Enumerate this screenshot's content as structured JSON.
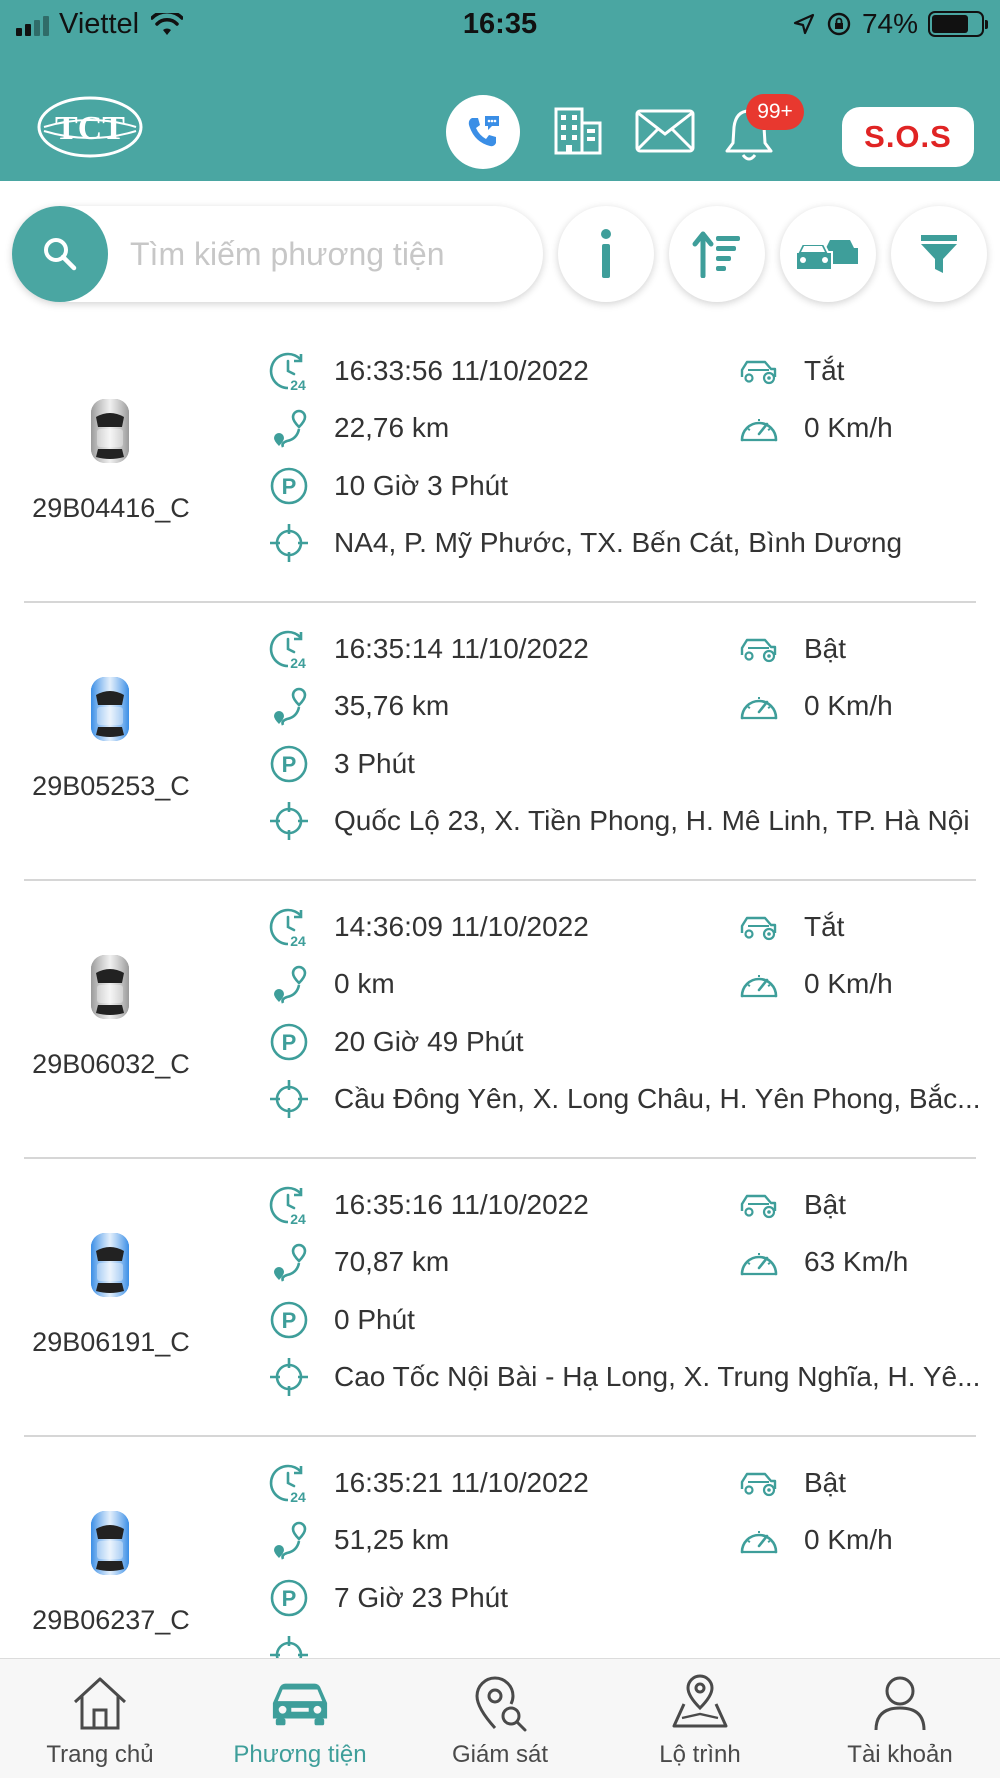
{
  "status_bar": {
    "carrier": "Viettel",
    "time": "16:35",
    "battery": "74%",
    "battery_level": 0.74
  },
  "header": {
    "logo_text": "TCT",
    "notification_count": "99+",
    "sos_label": "S.O.S"
  },
  "search": {
    "placeholder": "Tìm kiếm phương tiện"
  },
  "colors": {
    "brand": "#4aa6a2",
    "sos": "#e02424",
    "badge": "#e8382f",
    "car_off": "#9a9a9a",
    "car_on": "#3a8ee6"
  },
  "vehicles": [
    {
      "plate": "29B04416_C",
      "car_color": "gray",
      "timestamp": "16:33:56 11/10/2022",
      "distance": "22,76 km",
      "parked": "10 Giờ 3 Phút",
      "address": "NA4, P. Mỹ Phước, TX. Bến Cát, Bình Dương",
      "engine": "Tắt",
      "speed": "0 Km/h"
    },
    {
      "plate": "29B05253_C",
      "car_color": "blue",
      "timestamp": "16:35:14 11/10/2022",
      "distance": "35,76 km",
      "parked": "3 Phút",
      "address": "Quốc Lộ 23, X. Tiền Phong, H. Mê Linh, TP. Hà Nội",
      "engine": "Bật",
      "speed": "0 Km/h"
    },
    {
      "plate": "29B06032_C",
      "car_color": "gray",
      "timestamp": "14:36:09 11/10/2022",
      "distance": "0 km",
      "parked": "20 Giờ 49 Phút",
      "address": "Cầu Đông Yên, X. Long Châu, H. Yên Phong, Bắc...",
      "engine": "Tắt",
      "speed": "0 Km/h"
    },
    {
      "plate": "29B06191_C",
      "car_color": "blue",
      "timestamp": "16:35:16 11/10/2022",
      "distance": "70,87 km",
      "parked": "0 Phút",
      "address": "Cao Tốc Nội Bài - Hạ Long, X. Trung Nghĩa, H. Yê...",
      "engine": "Bật",
      "speed": "63 Km/h"
    },
    {
      "plate": "29B06237_C",
      "car_color": "blue",
      "timestamp": "16:35:21 11/10/2022",
      "distance": "51,25 km",
      "parked": "7 Giờ 23 Phút",
      "address": "",
      "engine": "Bật",
      "speed": "0 Km/h"
    }
  ],
  "nav": {
    "items": [
      {
        "label": "Trang chủ",
        "icon": "home-icon"
      },
      {
        "label": "Phương tiện",
        "icon": "car-icon",
        "active": true
      },
      {
        "label": "Giám sát",
        "icon": "location-search-icon"
      },
      {
        "label": "Lộ trình",
        "icon": "route-map-icon"
      },
      {
        "label": "Tài khoản",
        "icon": "user-icon"
      }
    ]
  }
}
